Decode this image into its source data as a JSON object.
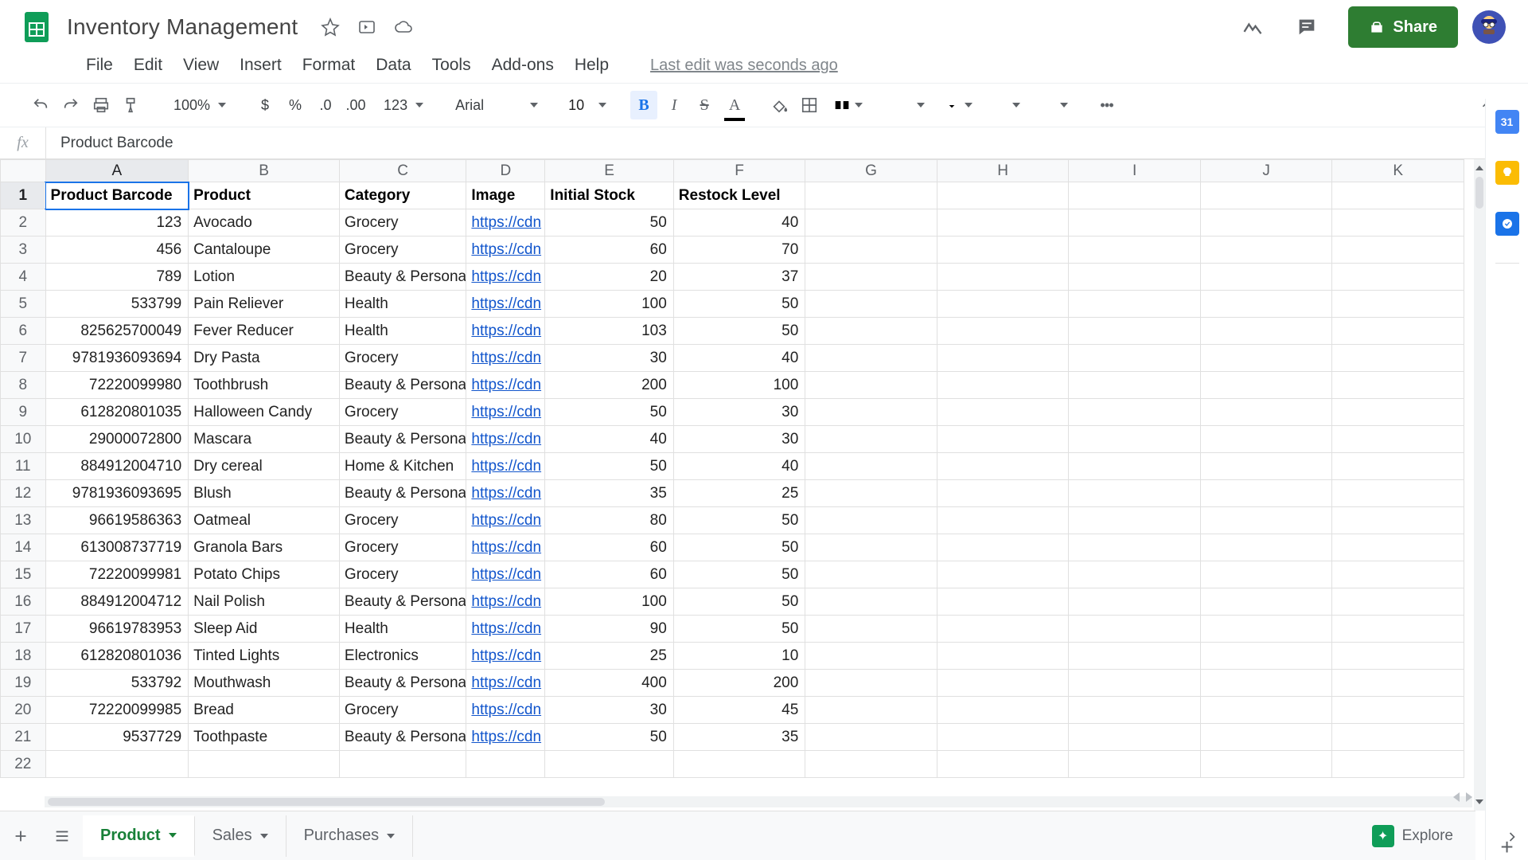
{
  "doc": {
    "title": "Inventory Management",
    "last_edit": "Last edit was seconds ago"
  },
  "menus": {
    "file": "File",
    "edit": "Edit",
    "view": "View",
    "insert": "Insert",
    "format": "Format",
    "data": "Data",
    "tools": "Tools",
    "addons": "Add-ons",
    "help": "Help"
  },
  "toolbar": {
    "zoom": "100%",
    "currency": "$",
    "percent": "%",
    "dec_less": ".0",
    "dec_more": ".00",
    "num_format": "123",
    "font": "Arial",
    "font_size": "10",
    "bold": "B",
    "italic": "I",
    "strike": "S",
    "textcolor": "A"
  },
  "share": {
    "label": "Share"
  },
  "formula": {
    "fx": "fx",
    "value": "Product Barcode"
  },
  "columns": [
    "A",
    "B",
    "C",
    "D",
    "E",
    "F",
    "G",
    "H",
    "I",
    "J",
    "K"
  ],
  "headers": {
    "A": "Product Barcode",
    "B": "Product",
    "C": "Category",
    "D": "Image",
    "E": "Initial Stock",
    "F": "Restock Level"
  },
  "link_text": "https://cdn",
  "rows": [
    {
      "n": 2,
      "A": "123",
      "B": "Avocado",
      "C": "Grocery",
      "E": "50",
      "F": "40"
    },
    {
      "n": 3,
      "A": "456",
      "B": "Cantaloupe",
      "C": "Grocery",
      "E": "60",
      "F": "70"
    },
    {
      "n": 4,
      "A": "789",
      "B": "Lotion",
      "C": "Beauty & Personal",
      "E": "20",
      "F": "37"
    },
    {
      "n": 5,
      "A": "533799",
      "B": "Pain Reliever",
      "C": "Health",
      "E": "100",
      "F": "50"
    },
    {
      "n": 6,
      "A": "825625700049",
      "B": "Fever Reducer",
      "C": "Health",
      "E": "103",
      "F": "50"
    },
    {
      "n": 7,
      "A": "9781936093694",
      "B": "Dry Pasta",
      "C": "Grocery",
      "E": "30",
      "F": "40"
    },
    {
      "n": 8,
      "A": "72220099980",
      "B": "Toothbrush",
      "C": "Beauty & Personal",
      "E": "200",
      "F": "100"
    },
    {
      "n": 9,
      "A": "612820801035",
      "B": "Halloween Candy",
      "C": "Grocery",
      "E": "50",
      "F": "30"
    },
    {
      "n": 10,
      "A": "29000072800",
      "B": "Mascara",
      "C": "Beauty & Personal",
      "E": "40",
      "F": "30"
    },
    {
      "n": 11,
      "A": "884912004710",
      "B": "Dry cereal",
      "C": "Home & Kitchen",
      "E": "50",
      "F": "40"
    },
    {
      "n": 12,
      "A": "9781936093695",
      "B": "Blush",
      "C": "Beauty & Personal",
      "E": "35",
      "F": "25"
    },
    {
      "n": 13,
      "A": "96619586363",
      "B": "Oatmeal",
      "C": "Grocery",
      "E": "80",
      "F": "50"
    },
    {
      "n": 14,
      "A": "613008737719",
      "B": "Granola Bars",
      "C": "Grocery",
      "E": "60",
      "F": "50"
    },
    {
      "n": 15,
      "A": "72220099981",
      "B": "Potato Chips",
      "C": "Grocery",
      "E": "60",
      "F": "50"
    },
    {
      "n": 16,
      "A": "884912004712",
      "B": "Nail Polish",
      "C": "Beauty & Personal",
      "E": "100",
      "F": "50"
    },
    {
      "n": 17,
      "A": "96619783953",
      "B": "Sleep Aid",
      "C": "Health",
      "E": "90",
      "F": "50"
    },
    {
      "n": 18,
      "A": "612820801036",
      "B": "Tinted Lights",
      "C": "Electronics",
      "E": "25",
      "F": "10"
    },
    {
      "n": 19,
      "A": "533792",
      "B": "Mouthwash",
      "C": "Beauty & Personal",
      "E": "400",
      "F": "200"
    },
    {
      "n": 20,
      "A": "72220099985",
      "B": "Bread",
      "C": "Grocery",
      "E": "30",
      "F": "45"
    },
    {
      "n": 21,
      "A": "9537729",
      "B": "Toothpaste",
      "C": "Beauty & Personal",
      "E": "50",
      "F": "35"
    }
  ],
  "empty_rows": [
    22
  ],
  "tabs": {
    "product": "Product",
    "sales": "Sales",
    "purchases": "Purchases"
  },
  "explore": {
    "label": "Explore"
  },
  "rail": {
    "cal": "31"
  }
}
